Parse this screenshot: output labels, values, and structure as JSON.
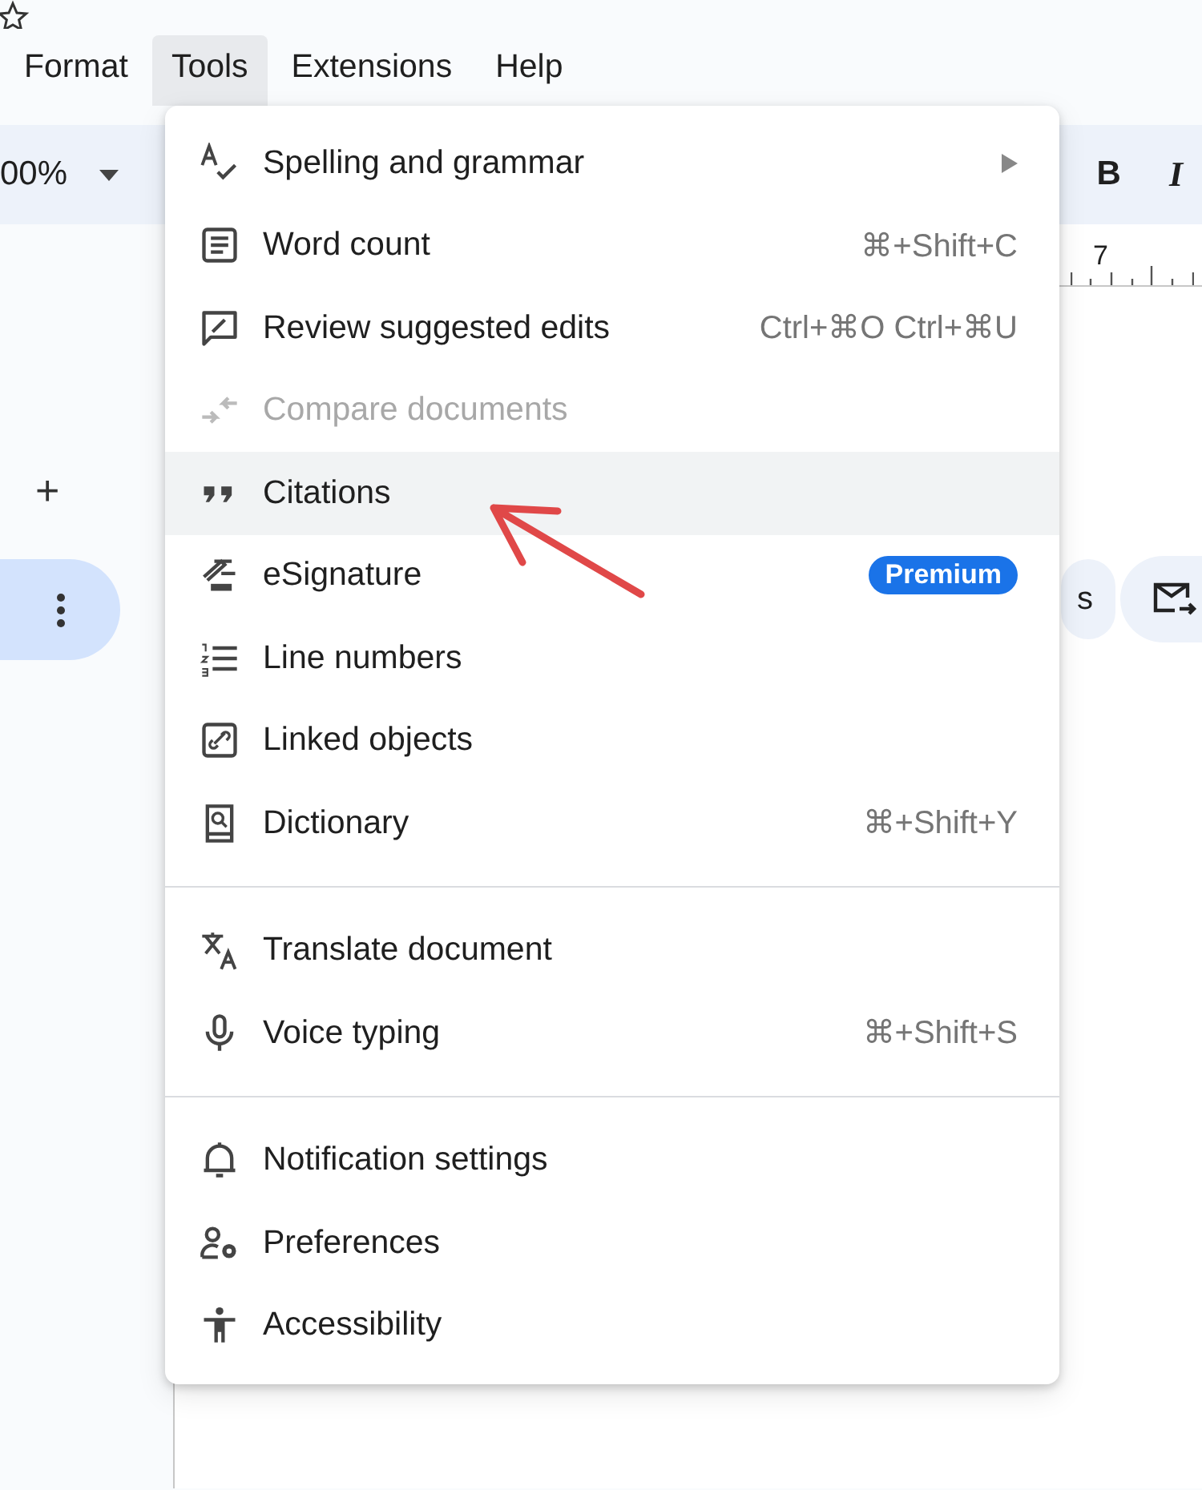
{
  "menu_bar": [
    {
      "label": "Format",
      "selected": false
    },
    {
      "label": "Tools",
      "selected": true
    },
    {
      "label": "Extensions",
      "selected": false
    },
    {
      "label": "Help",
      "selected": false
    }
  ],
  "toolbar": {
    "zoom": "00%",
    "bold": "B",
    "italic": "I"
  },
  "ruler": {
    "mark": "7"
  },
  "side_panel": {
    "add": "+"
  },
  "chip": {
    "label": "s"
  },
  "tools_menu": {
    "groups": [
      [
        {
          "label": "Spelling and grammar",
          "submenu": true,
          "disabled": false,
          "selected": false
        },
        {
          "label": "Word count",
          "shortcut": "⌘+Shift+C",
          "submenu": false,
          "disabled": false,
          "selected": false
        },
        {
          "label": "Review suggested edits",
          "shortcut": "Ctrl+⌘O Ctrl+⌘U",
          "submenu": false,
          "disabled": false,
          "selected": false
        },
        {
          "label": "Compare documents",
          "submenu": false,
          "disabled": true,
          "selected": false
        },
        {
          "label": "Citations",
          "submenu": false,
          "disabled": false,
          "selected": true
        },
        {
          "label": "eSignature",
          "badge": "Premium",
          "submenu": false,
          "disabled": false,
          "selected": false
        },
        {
          "label": "Line numbers",
          "submenu": false,
          "disabled": false,
          "selected": false
        },
        {
          "label": "Linked objects",
          "submenu": false,
          "disabled": false,
          "selected": false
        },
        {
          "label": "Dictionary",
          "shortcut": "⌘+Shift+Y",
          "submenu": false,
          "disabled": false,
          "selected": false
        }
      ],
      [
        {
          "label": "Translate document",
          "submenu": false,
          "disabled": false,
          "selected": false
        },
        {
          "label": "Voice typing",
          "shortcut": "⌘+Shift+S",
          "submenu": false,
          "disabled": false,
          "selected": false
        }
      ],
      [
        {
          "label": "Notification settings",
          "submenu": false,
          "disabled": false,
          "selected": false
        },
        {
          "label": "Preferences",
          "submenu": false,
          "disabled": false,
          "selected": false
        },
        {
          "label": "Accessibility",
          "submenu": false,
          "disabled": false,
          "selected": false
        }
      ]
    ]
  }
}
